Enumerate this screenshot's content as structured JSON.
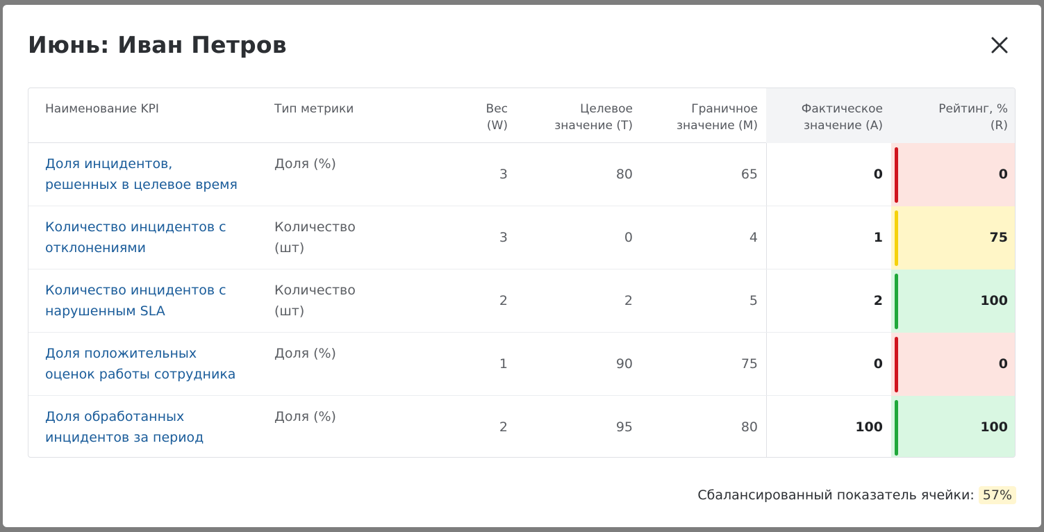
{
  "modal": {
    "title": "Июнь: Иван Петров",
    "close_icon": "close-icon"
  },
  "table": {
    "headers": {
      "name": "Наименование KPI",
      "type": "Тип метрики",
      "weight_l1": "Вес",
      "weight_l2": "(W)",
      "target_l1": "Целевое",
      "target_l2": "значение (T)",
      "limit_l1": "Граничное",
      "limit_l2": "значение (M)",
      "actual_l1": "Фактическое",
      "actual_l2": "значение (A)",
      "rating_l1": "Рейтинг, %",
      "rating_l2": "(R)"
    },
    "rows": [
      {
        "name_l1": "Доля инцидентов,",
        "name_l2": "решенных в целевое время",
        "type_l1": "Доля (%)",
        "type_l2": "",
        "weight": "3",
        "target": "80",
        "limit": "65",
        "actual": "0",
        "rating": "0",
        "status": "red"
      },
      {
        "name_l1": "Количество инцидентов с",
        "name_l2": "отклонениями",
        "type_l1": "Количество",
        "type_l2": "(шт)",
        "weight": "3",
        "target": "0",
        "limit": "4",
        "actual": "1",
        "rating": "75",
        "status": "yellow"
      },
      {
        "name_l1": "Количество инцидентов с",
        "name_l2": "нарушенным SLA",
        "type_l1": "Количество",
        "type_l2": "(шт)",
        "weight": "2",
        "target": "2",
        "limit": "5",
        "actual": "2",
        "rating": "100",
        "status": "green"
      },
      {
        "name_l1": "Доля положительных",
        "name_l2": "оценок работы сотрудника",
        "type_l1": "Доля (%)",
        "type_l2": "",
        "weight": "1",
        "target": "90",
        "limit": "75",
        "actual": "0",
        "rating": "0",
        "status": "red"
      },
      {
        "name_l1": "Доля обработанных",
        "name_l2": "инцидентов за период",
        "type_l1": "Доля (%)",
        "type_l2": "",
        "weight": "2",
        "target": "95",
        "limit": "80",
        "actual": "100",
        "rating": "100",
        "status": "green"
      }
    ]
  },
  "colors": {
    "red": {
      "bar": "#d0161f",
      "bg": "#fde4e0"
    },
    "yellow": {
      "bar": "#f5d20a",
      "bg": "#fff6c7"
    },
    "green": {
      "bar": "#1fa83a",
      "bg": "#d9f7e2"
    }
  },
  "footer": {
    "balance_label": "Сбалансированный показатель ячейки:",
    "balance_value": "57%"
  }
}
